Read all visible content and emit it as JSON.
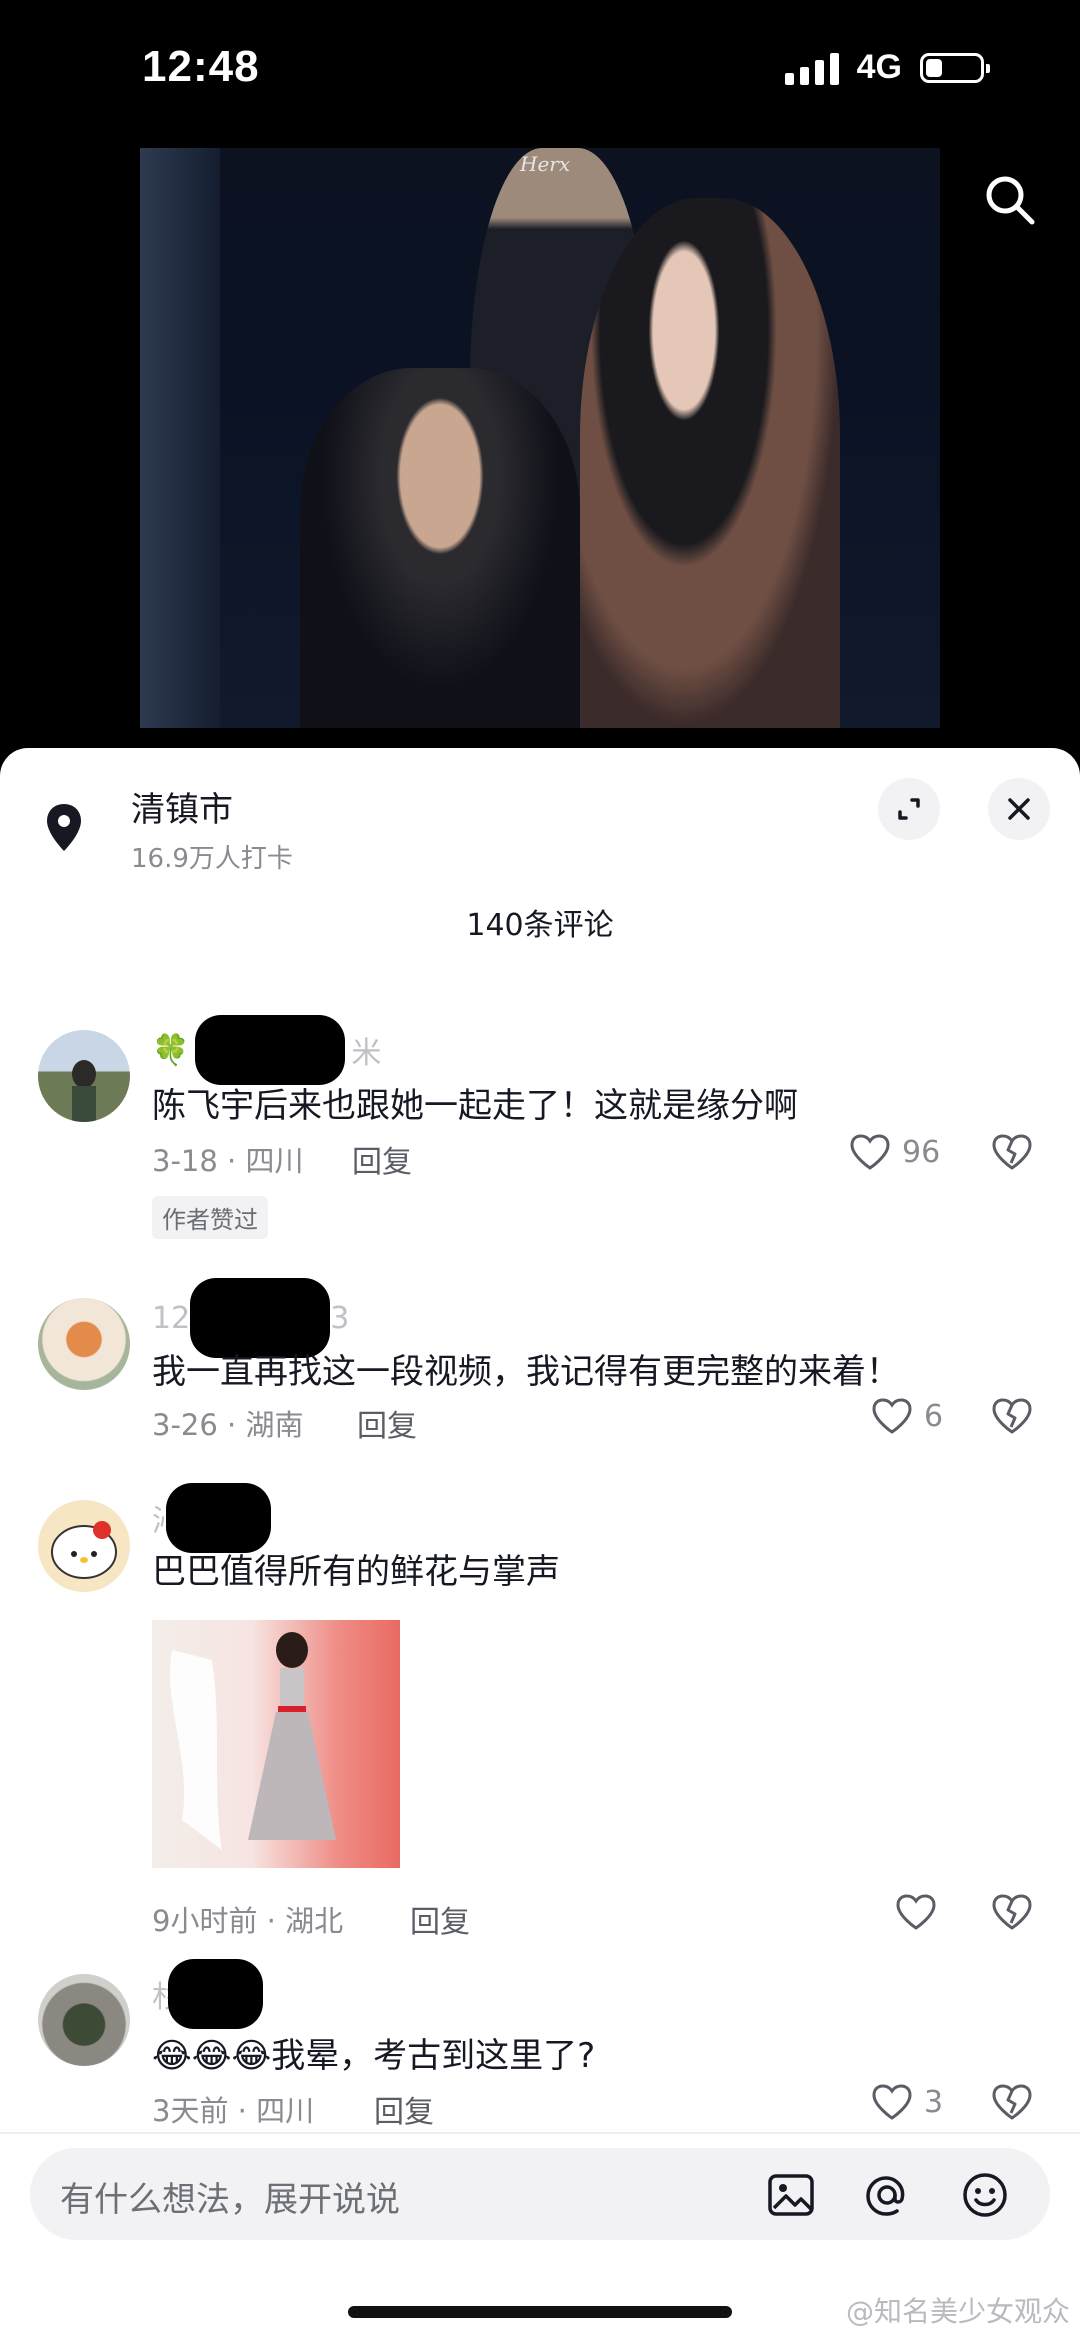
{
  "status": {
    "time": "12:48",
    "network": "4G"
  },
  "video": {
    "watermark": "Herx"
  },
  "location": {
    "title": "清镇市",
    "subtitle": "16.9万人打卡"
  },
  "comments_count": "140条评论",
  "comments": [
    {
      "name_fragment": "米",
      "text": "陈飞宇后来也跟她一起走了！这就是缘分啊",
      "date_location": "3-18 · 四川",
      "reply": "回复",
      "likes": "96",
      "badge": "作者赞过"
    },
    {
      "name_fragment_left": "12",
      "name_fragment_right": "3",
      "text": "我一直再找这一段视频，我记得有更完整的来着！",
      "date_location": "3-26 · 湖南",
      "reply": "回复",
      "likes": "6"
    },
    {
      "name_fragment": "沁",
      "text": "巴巴值得所有的鲜花与掌声",
      "date_location": "9小时前 · 湖北",
      "reply": "回复",
      "likes": ""
    },
    {
      "name_fragment": "杉",
      "emoji": "😂😂😂",
      "text": "我晕，考古到这里了?",
      "date_location": "3天前 · 四川",
      "reply": "回复",
      "likes": "3"
    }
  ],
  "input": {
    "placeholder": "有什么想法，展开说说"
  },
  "credit": "@知名美少女观众",
  "colors": {
    "background": "#000000",
    "sheet": "#ffffff",
    "muted": "#8a8b91"
  }
}
